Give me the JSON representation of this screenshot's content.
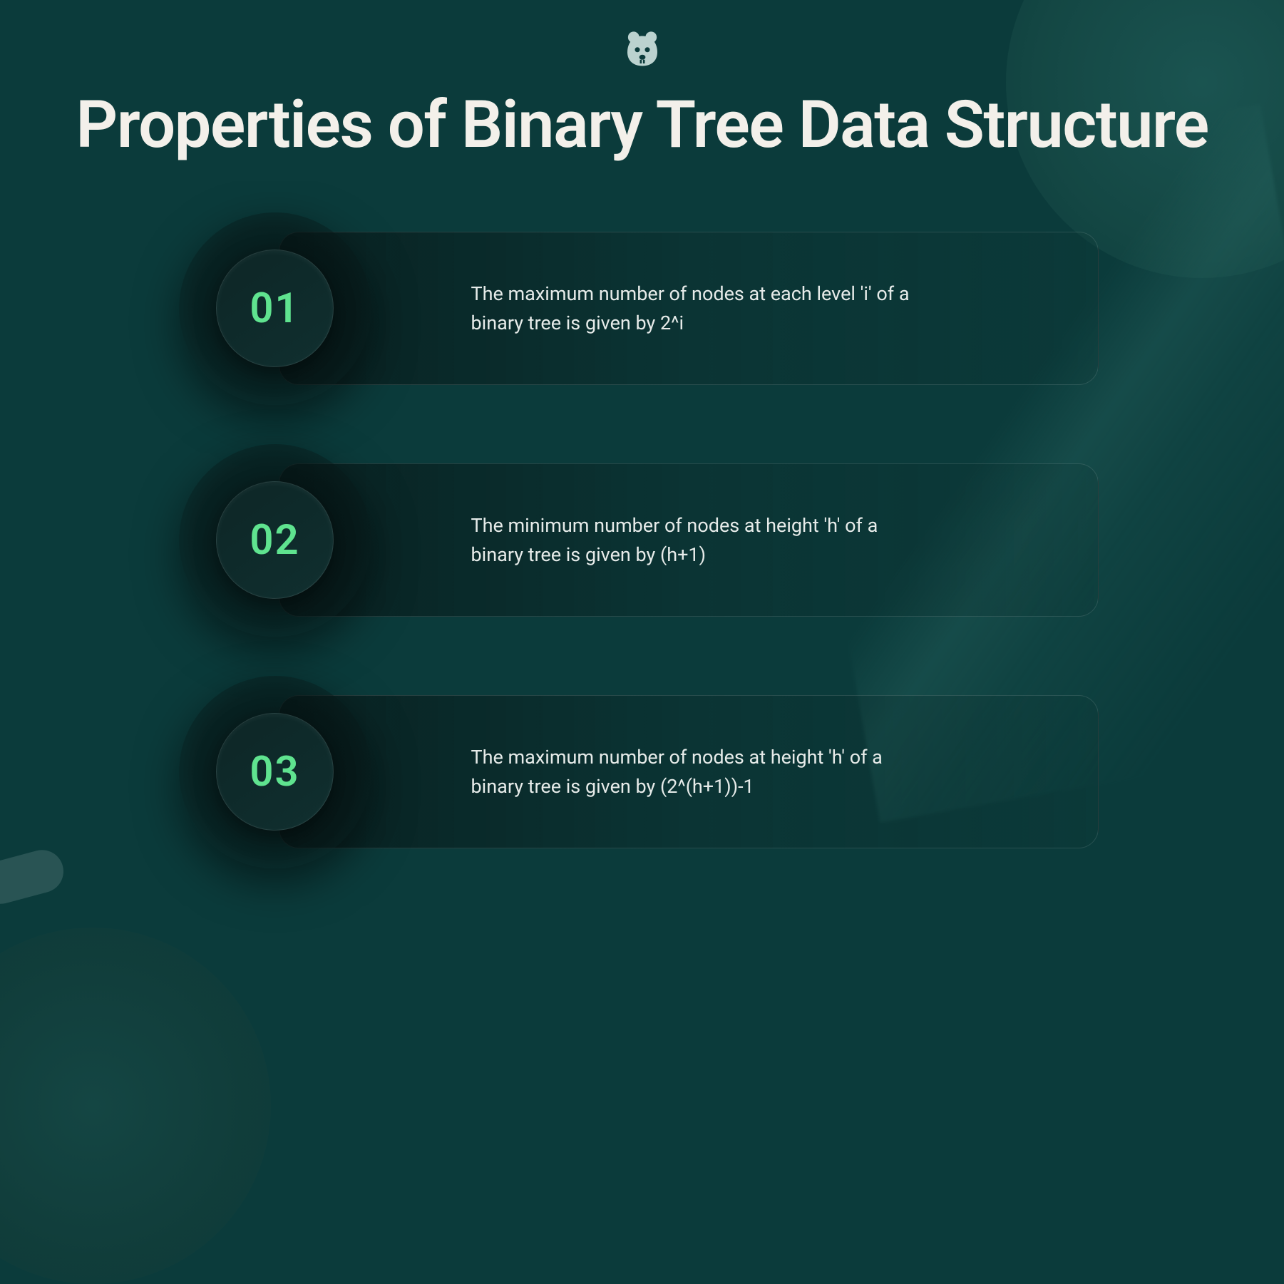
{
  "logo": {
    "name": "bear-mascot"
  },
  "title": "Properties of Binary Tree Data Structure",
  "items": [
    {
      "num": "01",
      "text": "The maximum number of nodes at each level 'i' of a binary tree is given by 2^i"
    },
    {
      "num": "02",
      "text": "The minimum number of nodes at height 'h' of a binary tree is given by (h+1)"
    },
    {
      "num": "03",
      "text": "The maximum number of nodes at height 'h' of a binary tree is given by (2^(h+1))-1"
    }
  ],
  "colors": {
    "accent": "#5fe38f",
    "bg": "#0b3b3b",
    "title": "#f3f0ea"
  }
}
